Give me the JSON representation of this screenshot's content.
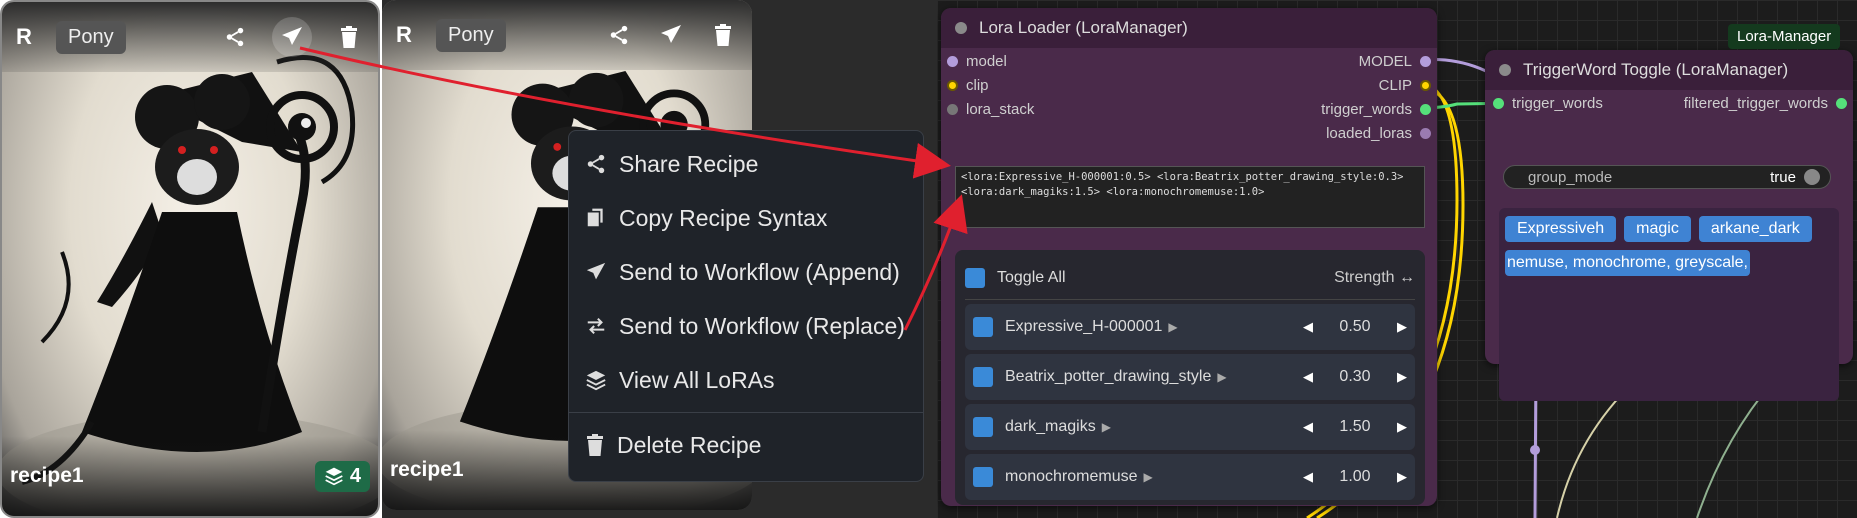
{
  "card1": {
    "logo": "R",
    "base_model": "Pony",
    "name": "recipe1",
    "lora_count": "4"
  },
  "card2": {
    "logo": "R",
    "base_model": "Pony",
    "name": "recipe1"
  },
  "context_menu": {
    "items": [
      {
        "label": "Share Recipe",
        "icon": "share-icon"
      },
      {
        "label": "Copy Recipe Syntax",
        "icon": "copy-icon"
      },
      {
        "label": "Send to Workflow (Append)",
        "icon": "send-icon"
      },
      {
        "label": "Send to Workflow (Replace)",
        "icon": "swap-icon"
      },
      {
        "label": "View All LoRAs",
        "icon": "layers-icon"
      },
      {
        "label": "Delete Recipe",
        "icon": "trash-icon"
      }
    ]
  },
  "lora_loader": {
    "title": "Lora Loader (LoraManager)",
    "inputs": [
      "model",
      "clip",
      "lora_stack"
    ],
    "outputs": [
      "MODEL",
      "CLIP",
      "trigger_words",
      "loaded_loras"
    ],
    "syntax_lines": [
      "<lora:Expressive_H-000001:0.5> <lora:Beatrix_potter_drawing_style:0.3>",
      "<lora:dark_magiks:1.5> <lora:monochromemuse:1.0>"
    ],
    "toggle_all": "Toggle All",
    "strength_label": "Strength ↔",
    "loras": [
      {
        "name": "Expressive_H-000001",
        "strength": "0.50"
      },
      {
        "name": "Beatrix_potter_drawing_style",
        "strength": "0.30"
      },
      {
        "name": "dark_magiks",
        "strength": "1.50"
      },
      {
        "name": "monochromemuse",
        "strength": "1.00"
      }
    ]
  },
  "group_badge": "Lora-Manager",
  "trigger_toggle": {
    "title": "TriggerWord Toggle (LoraManager)",
    "input": "trigger_words",
    "output": "filtered_trigger_words",
    "group_mode_label": "group_mode",
    "group_mode_value": "true",
    "tags": [
      "Expressiveh",
      "magic",
      "arkane_dark",
      "nemuse, monochrome, greyscale,"
    ]
  },
  "colors": {
    "node_body": "#4a2a4a",
    "menu_bg": "#1f2329",
    "tag_blue": "#3f83d3",
    "badge_green": "#1e6b47",
    "arrow_red": "#e0202e"
  }
}
